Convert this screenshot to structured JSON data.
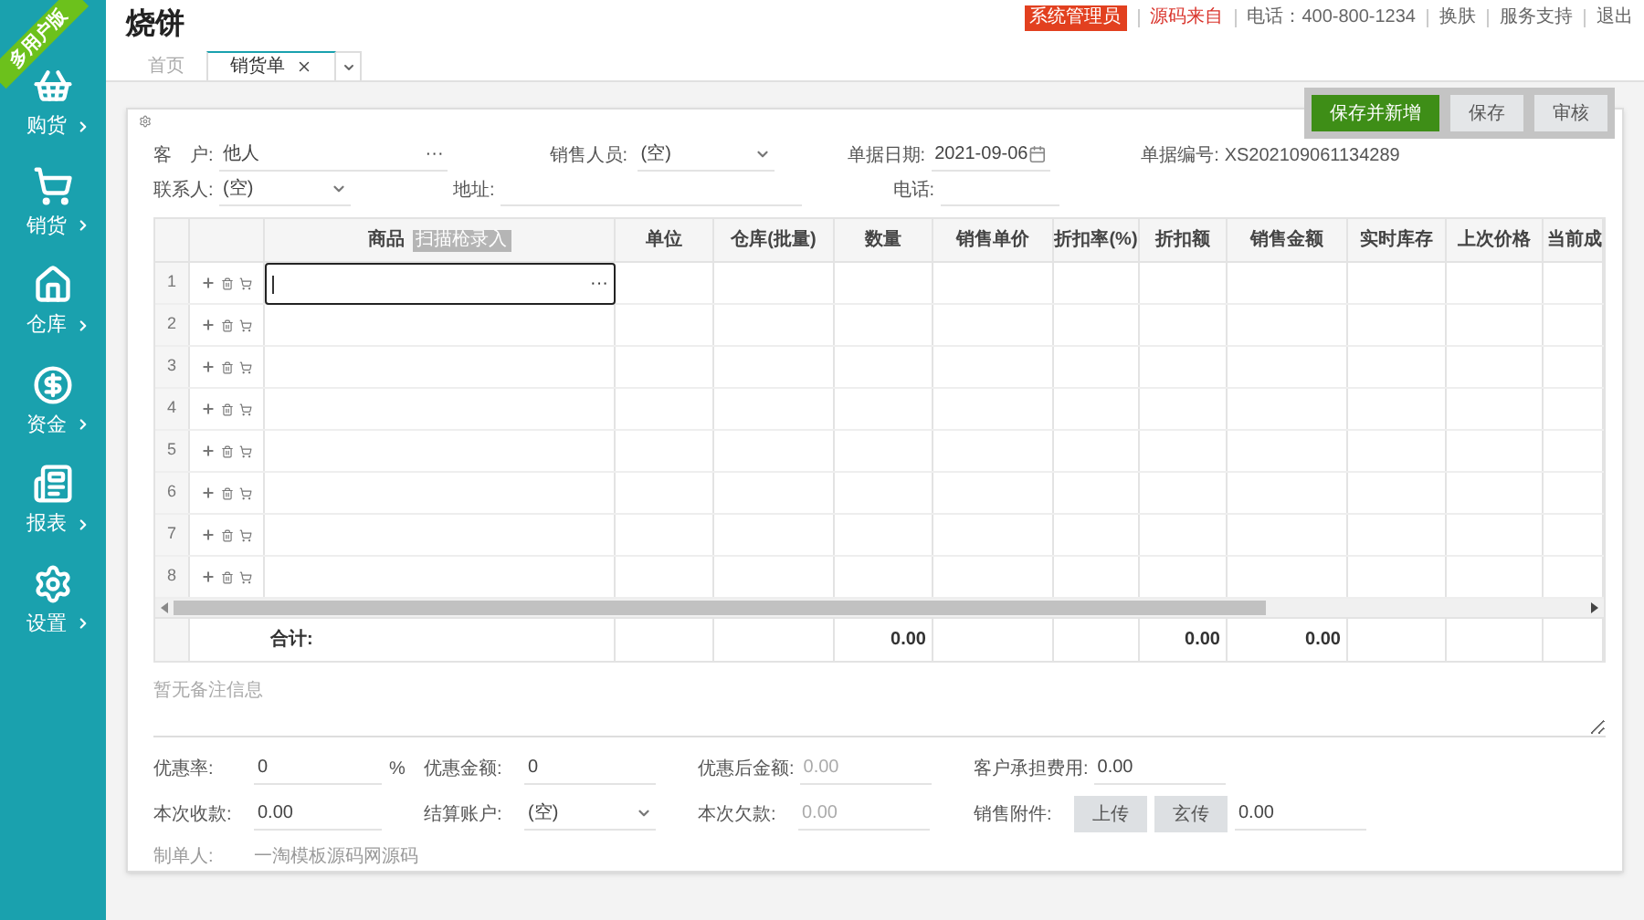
{
  "brand_ribbon": "多用户版",
  "sidebar": {
    "items": [
      {
        "label": "购货"
      },
      {
        "label": "销货"
      },
      {
        "label": "仓库"
      },
      {
        "label": "资金"
      },
      {
        "label": "报表"
      },
      {
        "label": "设置"
      }
    ]
  },
  "page_title": "烧饼",
  "top_links": [
    {
      "text": "系统管理员",
      "kind": "badge"
    },
    {
      "text": "源码来自",
      "kind": "alert"
    },
    {
      "text": "电话：400-800-1234",
      "kind": "plain"
    },
    {
      "text": "换肤",
      "kind": "plain"
    },
    {
      "text": "服务支持",
      "kind": "plain"
    },
    {
      "text": "退出",
      "kind": "plain"
    }
  ],
  "tabs": [
    {
      "label": "首页",
      "selected": false,
      "closable": false
    },
    {
      "label": "销货单",
      "selected": true,
      "closable": true
    }
  ],
  "toolbar_buttons": [
    {
      "label": "保存并新增",
      "kind": "primary"
    },
    {
      "label": "保存",
      "kind": "default"
    },
    {
      "label": "审核",
      "kind": "default"
    }
  ],
  "header_rows": [
    [
      {
        "label": "客　户:",
        "value": "他人",
        "kind": "lookup",
        "more": "···"
      },
      {
        "label": "销售人员:",
        "value": "(空)",
        "kind": "select"
      },
      {
        "label": "单据日期:",
        "value": "2021-09-06",
        "kind": "date"
      },
      {
        "label": "单据编号:",
        "value": "XS202109061134289",
        "kind": "plain"
      }
    ],
    [
      {
        "label": "联系人:",
        "value": "(空)",
        "kind": "select"
      },
      {
        "label": "地址:",
        "kind": "text"
      },
      {
        "label": "电话:",
        "kind": "text"
      }
    ]
  ],
  "table": {
    "columns": [
      {
        "label": "商品",
        "badge": "扫描枪录入"
      },
      {
        "label": "单位"
      },
      {
        "label": "仓库(批量)"
      },
      {
        "label": "数量",
        "total": "0.00"
      },
      {
        "label": "销售单价"
      },
      {
        "label": "折扣率(%)"
      },
      {
        "label": "折扣额",
        "total": "0.00"
      },
      {
        "label": "销售金额",
        "total": "0.00"
      },
      {
        "label": "实时库存"
      },
      {
        "label": "上次价格"
      },
      {
        "label": "当前成"
      }
    ],
    "rows": [
      {
        "index": "1",
        "editing": true,
        "more": "···"
      },
      {
        "index": "2",
        "editing": false
      },
      {
        "index": "3",
        "editing": false
      },
      {
        "index": "4",
        "editing": false
      },
      {
        "index": "5",
        "editing": false
      },
      {
        "index": "6",
        "editing": false
      },
      {
        "index": "7",
        "editing": false
      },
      {
        "index": "8",
        "editing": false
      }
    ],
    "total_label": "合计:"
  },
  "remark": {
    "placeholder": "暂无备注信息"
  },
  "footer_rows": [
    [
      {
        "label": "优惠率:",
        "value": "0",
        "suffix": "%",
        "kind": "text"
      },
      {
        "label": "优惠金额:",
        "value": "0",
        "kind": "text"
      },
      {
        "label": "优惠后金额:",
        "value": "0.00",
        "kind": "readonly"
      },
      {
        "label": "客户承担费用:",
        "value": "0.00",
        "kind": "text"
      }
    ],
    [
      {
        "label": "本次收款:",
        "value": "0.00",
        "kind": "text"
      },
      {
        "label": "结算账户:",
        "value": "(空)",
        "kind": "select"
      },
      {
        "label": "本次欠款:",
        "value": "0.00",
        "kind": "readonly"
      },
      {
        "label": "销售附件:",
        "value": "0.00",
        "kind": "upload",
        "buttons": [
          "上传",
          "玄传"
        ]
      }
    ],
    [
      {
        "label": "制单人:",
        "value": "一淘模板源码网源码",
        "kind": "static"
      }
    ]
  ]
}
